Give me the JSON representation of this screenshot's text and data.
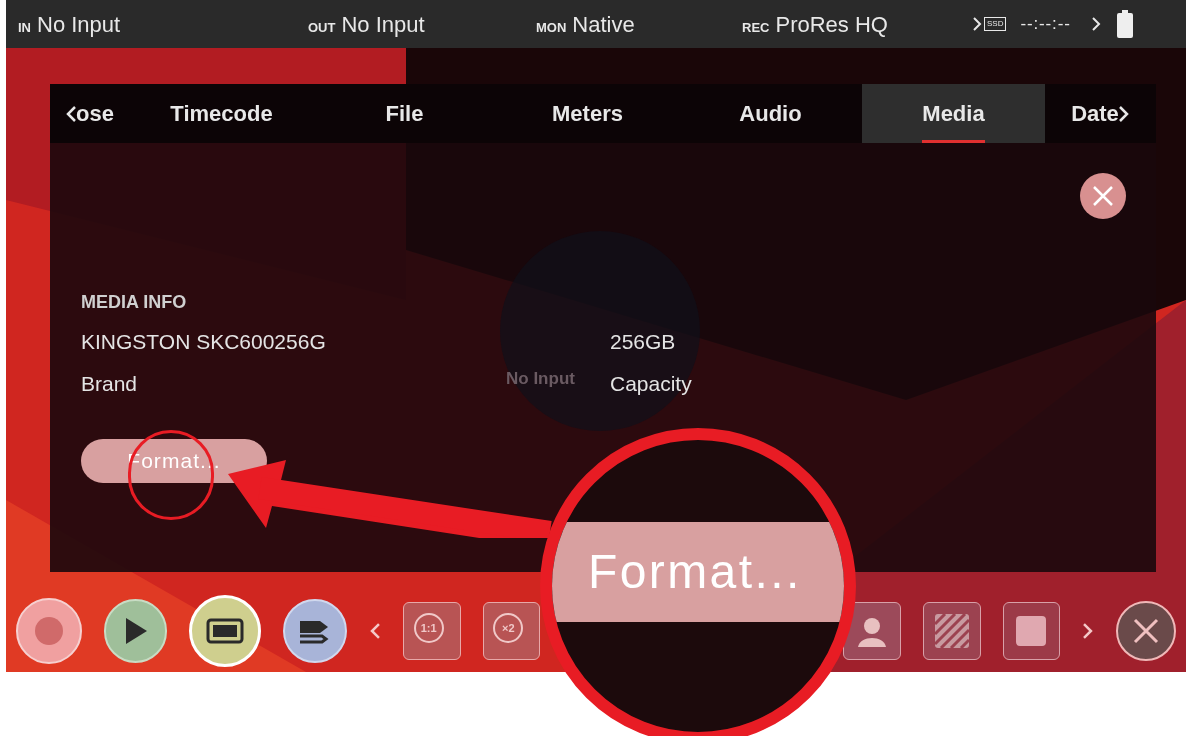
{
  "status_bar": [
    {
      "tag": "IN",
      "value": "No Input"
    },
    {
      "tag": "OUT",
      "value": "No Input"
    },
    {
      "tag": "MON",
      "value": "Native"
    },
    {
      "tag": "REC",
      "value": "ProRes HQ"
    }
  ],
  "drive": {
    "badge": "SSD",
    "timecode": "--:--:--"
  },
  "tabs": [
    {
      "label": "ose",
      "selected": false,
      "kind": "prev"
    },
    {
      "label": "Timecode",
      "selected": false,
      "kind": "plain"
    },
    {
      "label": "File",
      "selected": false,
      "kind": "plain"
    },
    {
      "label": "Meters",
      "selected": false,
      "kind": "plain"
    },
    {
      "label": "Audio",
      "selected": false,
      "kind": "plain"
    },
    {
      "label": "Media",
      "selected": true,
      "kind": "plain"
    },
    {
      "label": "Date",
      "selected": false,
      "kind": "next"
    }
  ],
  "media_info": {
    "heading": "MEDIA INFO",
    "brand_value": "KINGSTON SKC600256G",
    "brand_label": "Brand",
    "capacity_value": "256GB",
    "capacity_label": "Capacity",
    "format_button": "Format..."
  },
  "ghost_text": "No Input",
  "toolbar": [
    {
      "kind": "record"
    },
    {
      "kind": "play"
    },
    {
      "kind": "monitor"
    },
    {
      "kind": "tags"
    },
    {
      "kind": "prev"
    },
    {
      "kind": "zoom",
      "label": "1:1"
    },
    {
      "kind": "zoom",
      "label": "×2"
    },
    {
      "kind": "gap"
    },
    {
      "kind": "person"
    },
    {
      "kind": "hatch"
    },
    {
      "kind": "square"
    },
    {
      "kind": "next"
    },
    {
      "kind": "close"
    }
  ],
  "annotation": {
    "magnified_text": "Format..."
  }
}
